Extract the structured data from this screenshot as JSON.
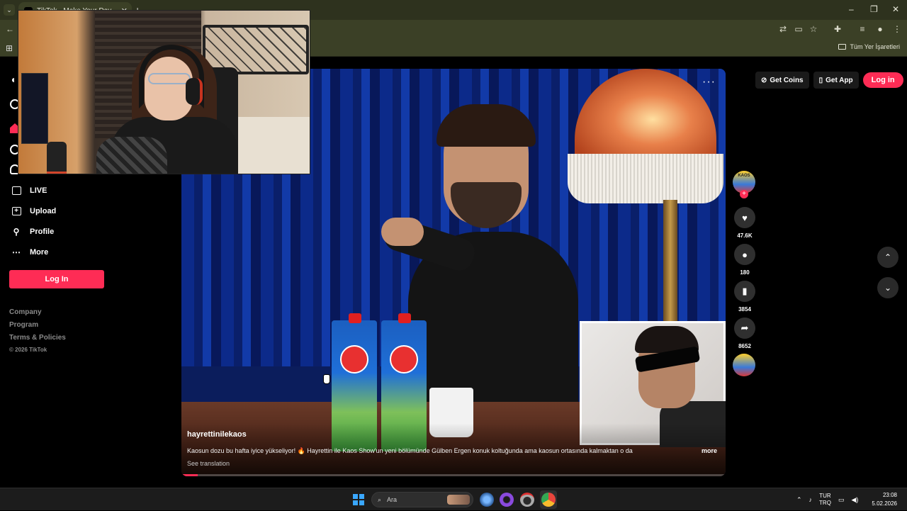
{
  "browser": {
    "tab_title": "TikTok - Make Your Day",
    "new_tab_icon": "plus-icon",
    "all_bookmarks_label": "Tüm Yer İşaretleri",
    "window_controls": [
      "–",
      "❐",
      "✕"
    ]
  },
  "sidebar": {
    "items": [
      {
        "label": "LIVE",
        "icon": "live-icon"
      },
      {
        "label": "Upload",
        "icon": "upload-icon"
      },
      {
        "label": "Profile",
        "icon": "profile-icon"
      },
      {
        "label": "More",
        "icon": "more-icon"
      }
    ],
    "login_label": "Log In",
    "footer_links": [
      "Company",
      "Program",
      "Terms & Policies"
    ],
    "copyright": "© 2026 TikTok"
  },
  "header": {
    "get_coins_label": "Get Coins",
    "get_app_label": "Get App",
    "login_label": "Log in"
  },
  "video": {
    "author": "hayrettinilekaos",
    "caption": "Kaosun dozu bu hafta iyice yükseliyor! 🔥 Hayrettin ile Kaos Show'un yeni bölümünde Gülben Ergen konuk koltuğunda ama kaosun ortasında kalmaktan o da",
    "more_label": "more",
    "see_translation_label": "See translation",
    "progress_fraction": 0.03,
    "more_options_icon": "ellipsis-icon"
  },
  "actions": {
    "avatar_label": "KAOS",
    "likes": "47.6K",
    "comments": "180",
    "saves": "3854",
    "shares": "8652"
  },
  "taskbar": {
    "search_placeholder": "Ara",
    "lang_top": "TUR",
    "lang_bottom": "TRQ",
    "time": "23:08",
    "date": "5.02.2026"
  },
  "colors": {
    "brand": "#fe2c55",
    "browser_frame": "#3b4026"
  }
}
